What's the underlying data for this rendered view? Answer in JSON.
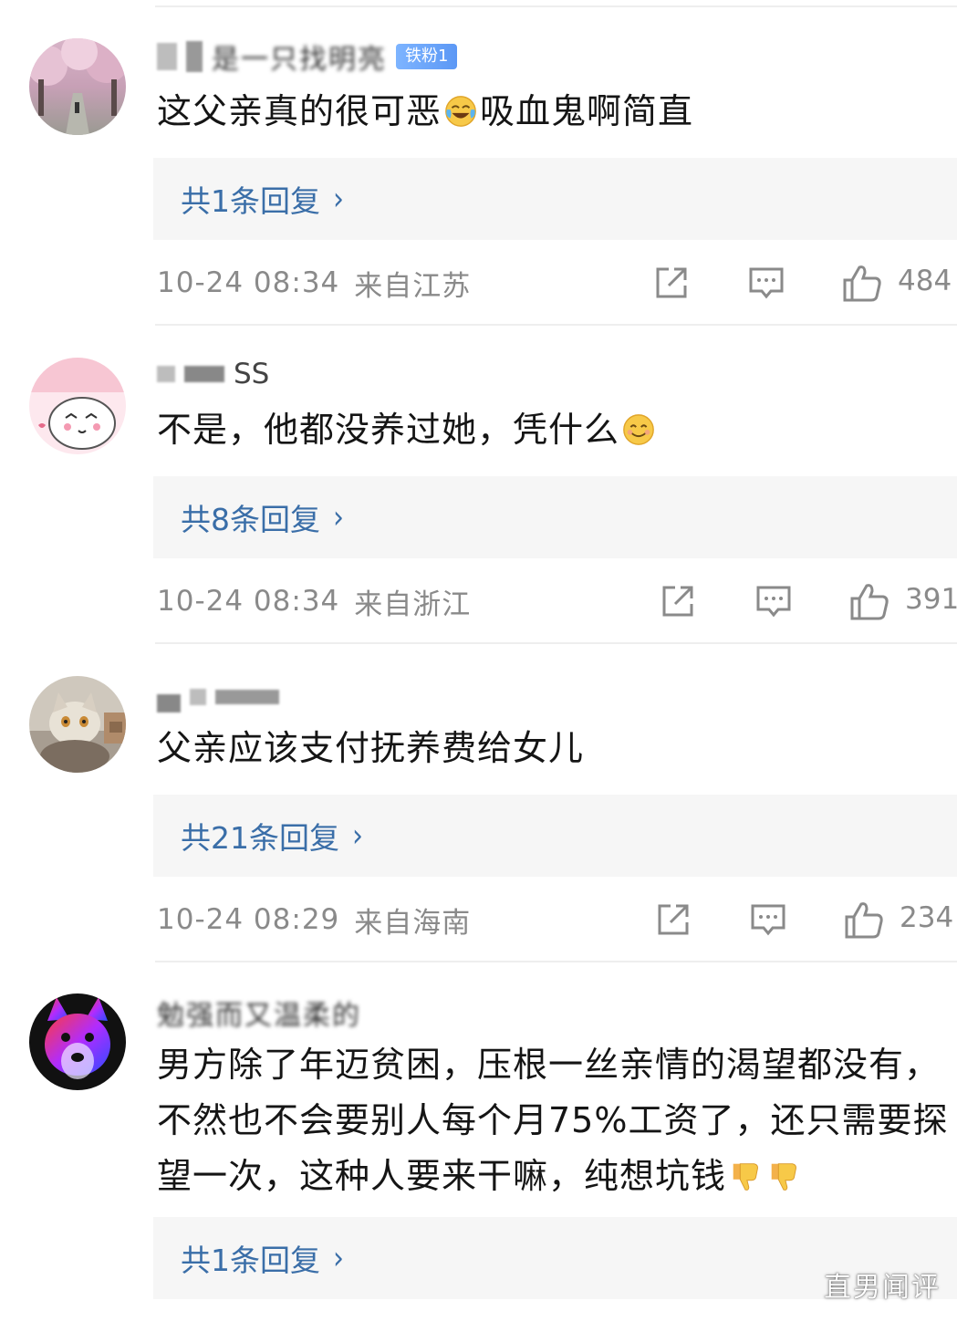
{
  "comments": [
    {
      "username": "是一只找明亮",
      "fan_badge": "铁粉1",
      "text": "这父亲真的很可恶",
      "emoji": "crying-laughing-emoji",
      "text_after_emoji": "吸血鬼啊简直",
      "reply_label": "共1条回复",
      "time": "10-24 08:34",
      "location": "来自江苏",
      "likes": "484"
    },
    {
      "username": "SS",
      "text": "不是，他都没养过她，凭什么",
      "emoji": "smile-emoji",
      "reply_label": "共8条回复",
      "time": "10-24 08:34",
      "location": "来自浙江",
      "likes": "391"
    },
    {
      "username": "",
      "text": "父亲应该支付抚养费给女儿",
      "reply_label": "共21条回复",
      "time": "10-24 08:29",
      "location": "来自海南",
      "likes": "234"
    },
    {
      "username": "勉强而又温柔的",
      "text": "男方除了年迈贫困，压根一丝亲情的渴望都没有，不然也不会要别人每个月75%工资了，还只需要探望一次，这种人要来干嘛，纯想坑钱",
      "emoji": "thumbs-down-emoji",
      "reply_label": "共1条回复"
    }
  ],
  "watermark": "直男闻评",
  "colors": {
    "reply_link": "#3a6ea8",
    "reply_bg": "#f6f6f6",
    "meta_text": "#8a8a8a",
    "badge": "#6aa4f7"
  }
}
